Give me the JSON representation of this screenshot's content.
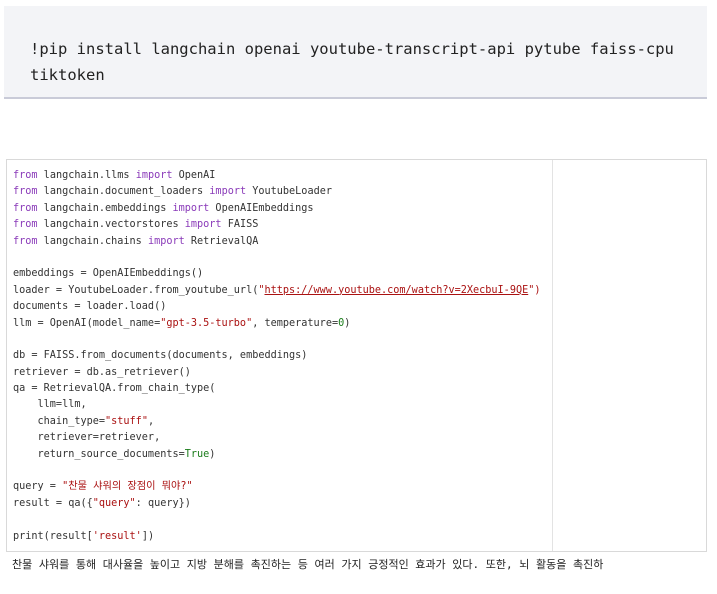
{
  "install": {
    "command": "!pip install langchain openai youtube-transcript-api pytube faiss-cpu tiktoken"
  },
  "code": {
    "line1": {
      "a": "from",
      "b": " langchain.llms ",
      "c": "import",
      "d": " OpenAI"
    },
    "line2": {
      "a": "from",
      "b": " langchain.document_loaders ",
      "c": "import",
      "d": " YoutubeLoader"
    },
    "line3": {
      "a": "from",
      "b": " langchain.embeddings ",
      "c": "import",
      "d": " OpenAIEmbeddings"
    },
    "line4": {
      "a": "from",
      "b": " langchain.vectorstores ",
      "c": "import",
      "d": " FAISS"
    },
    "line5": {
      "a": "from",
      "b": " langchain.chains ",
      "c": "import",
      "d": " RetrievalQA"
    },
    "line7": "embeddings = OpenAIEmbeddings()",
    "line8": {
      "a": "loader = YoutubeLoader.from_youtube_url(",
      "b": "\"",
      "url": "https://www.youtube.com/watch?v=2XecbuI-9QE",
      "c": "\")"
    },
    "line9": "documents = loader.load()",
    "line10": {
      "a": "llm = OpenAI(model_name=",
      "b": "\"gpt-3.5-turbo\"",
      "c": ", temperature=",
      "d": "0",
      "e": ")"
    },
    "line12": "db = FAISS.from_documents(documents, embeddings)",
    "line13": "retriever = db.as_retriever()",
    "line14": "qa = RetrievalQA.from_chain_type(",
    "line15": "    llm=llm,",
    "line16": {
      "a": "    chain_type=",
      "b": "\"stuff\"",
      "c": ","
    },
    "line17": "    retriever=retriever,",
    "line18": {
      "a": "    return_source_documents=",
      "b": "True",
      "c": ")"
    },
    "line20": {
      "a": "query = ",
      "b": "\"찬물 샤워의 장점이 뭐야?\""
    },
    "line21": {
      "a": "result = qa({",
      "b": "\"query\"",
      "c": ": query})"
    },
    "line23": {
      "a": "print(result[",
      "b": "'result'",
      "c": "])"
    }
  },
  "output": {
    "text": "찬물 샤워를 통해 대사율을 높이고 지방 분해를 촉진하는 등 여러 가지 긍정적인 효과가 있다. 또한, 뇌 활동을 촉진하"
  }
}
